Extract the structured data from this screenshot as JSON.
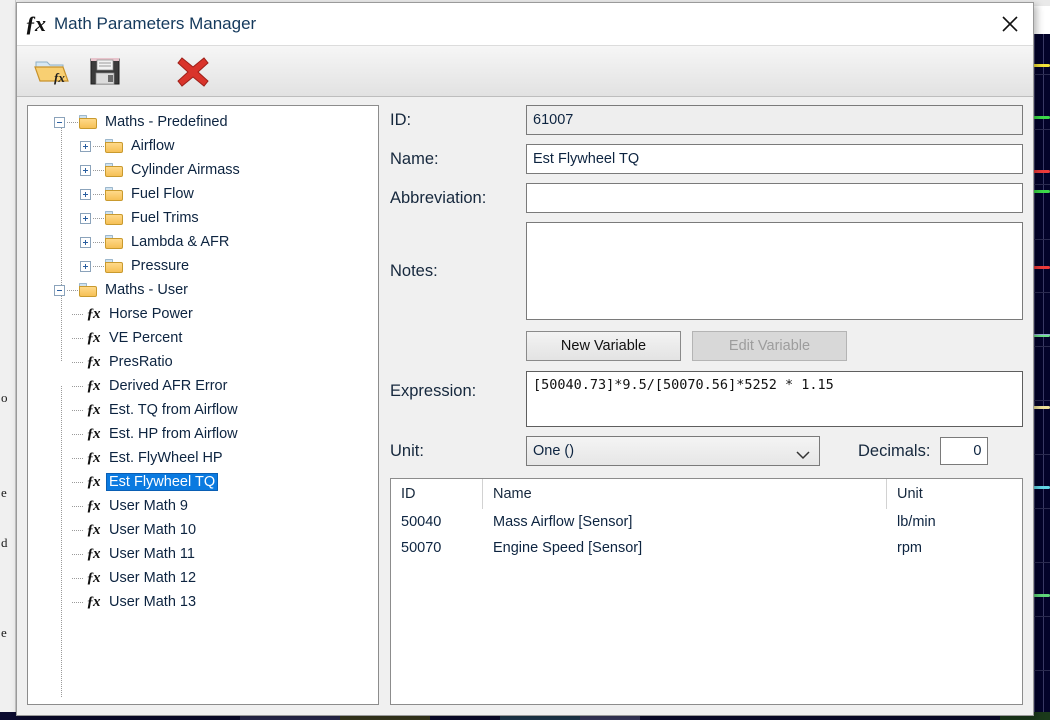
{
  "window": {
    "title": "Math Parameters Manager",
    "fx_icon": "fx-icon",
    "close_icon": "close-icon"
  },
  "toolbar": {
    "buttons": [
      {
        "name": "open-maths-button",
        "icon": "folder-fx-icon",
        "label": "Open"
      },
      {
        "name": "save-maths-button",
        "icon": "floppy-save-icon",
        "label": "Save"
      },
      {
        "name": "delete-math-button",
        "icon": "red-x-delete-icon",
        "label": "Delete"
      }
    ]
  },
  "tree": {
    "nodes": [
      {
        "label": "Maths - Predefined",
        "type": "folder",
        "depth": 0,
        "toggle": "minus"
      },
      {
        "label": "Airflow",
        "type": "folder",
        "depth": 1,
        "toggle": "plus"
      },
      {
        "label": "Cylinder Airmass",
        "type": "folder",
        "depth": 1,
        "toggle": "plus"
      },
      {
        "label": "Fuel Flow",
        "type": "folder",
        "depth": 1,
        "toggle": "plus"
      },
      {
        "label": "Fuel Trims",
        "type": "folder",
        "depth": 1,
        "toggle": "plus"
      },
      {
        "label": "Lambda & AFR",
        "type": "folder",
        "depth": 1,
        "toggle": "plus"
      },
      {
        "label": "Pressure",
        "type": "folder",
        "depth": 1,
        "toggle": "plus"
      },
      {
        "label": "Maths - User",
        "type": "folder",
        "depth": 0,
        "toggle": "minus"
      },
      {
        "label": "Horse Power",
        "type": "fx",
        "depth": 1,
        "toggle": "none"
      },
      {
        "label": "VE Percent",
        "type": "fx",
        "depth": 1,
        "toggle": "none"
      },
      {
        "label": "PresRatio",
        "type": "fx",
        "depth": 1,
        "toggle": "none"
      },
      {
        "label": "Derived AFR Error",
        "type": "fx",
        "depth": 1,
        "toggle": "none"
      },
      {
        "label": "Est. TQ from Airflow",
        "type": "fx",
        "depth": 1,
        "toggle": "none"
      },
      {
        "label": "Est. HP from Airflow",
        "type": "fx",
        "depth": 1,
        "toggle": "none"
      },
      {
        "label": "Est. FlyWheel HP",
        "type": "fx",
        "depth": 1,
        "toggle": "none"
      },
      {
        "label": "Est Flywheel TQ",
        "type": "fx",
        "depth": 1,
        "toggle": "none",
        "selected": true
      },
      {
        "label": "User Math 9",
        "type": "fx",
        "depth": 1,
        "toggle": "none"
      },
      {
        "label": "User Math 10",
        "type": "fx",
        "depth": 1,
        "toggle": "none"
      },
      {
        "label": "User Math 11",
        "type": "fx",
        "depth": 1,
        "toggle": "none"
      },
      {
        "label": "User Math 12",
        "type": "fx",
        "depth": 1,
        "toggle": "none"
      },
      {
        "label": "User Math 13",
        "type": "fx",
        "depth": 1,
        "toggle": "none"
      }
    ],
    "selection_color": "#0a7ae0"
  },
  "form": {
    "id": {
      "label": "ID:",
      "value": "61007",
      "readonly": true
    },
    "name": {
      "label": "Name:",
      "value": "Est Flywheel TQ",
      "placeholder": ""
    },
    "abbreviation": {
      "label": "Abbreviation:",
      "value": "",
      "placeholder": ""
    },
    "notes": {
      "label": "Notes:",
      "value": "",
      "placeholder": ""
    },
    "new_variable_button": {
      "label": "New Variable",
      "enabled": true
    },
    "edit_variable_button": {
      "label": "Edit Variable",
      "enabled": false
    },
    "expression": {
      "label": "Expression:",
      "value": "[50040.73]*9.5/[50070.56]*5252 * 1.15"
    },
    "unit": {
      "label": "Unit:",
      "value": "One ()",
      "chevron_icon": "chevron-down-icon"
    },
    "decimals": {
      "label": "Decimals:",
      "value": "0"
    }
  },
  "variables_table": {
    "columns": [
      "ID",
      "Name",
      "Unit"
    ],
    "rows": [
      {
        "id": "50040",
        "name": "Mass Airflow [Sensor]",
        "unit": "lb/min"
      },
      {
        "id": "50070",
        "name": "Engine Speed [Sensor]",
        "unit": "rpm"
      }
    ]
  },
  "background": {
    "left_fragments": [
      "o",
      "e",
      "d",
      "e"
    ],
    "chart_bg_color": "#03032a",
    "trace_colors": [
      "#f2e23a",
      "#3ddc4a",
      "#ef3b3b",
      "#3ddc4a",
      "#ef3b3b",
      "#6fe08c",
      "#f0e39a",
      "#63d8e8",
      "#5fd87a"
    ]
  }
}
